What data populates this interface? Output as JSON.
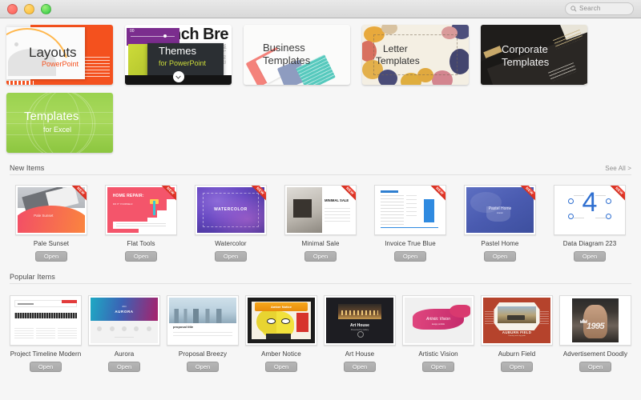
{
  "window": {
    "traffic_lights": [
      "close",
      "minimize",
      "maximize"
    ],
    "search": {
      "placeholder": "Search",
      "icon": "search-icon"
    }
  },
  "featured": {
    "cards": [
      {
        "id": "layouts",
        "title_line1": "Layouts",
        "title_line2": "PowerPoint",
        "body_text": "Lorem ipsum dolor sit consectetur adipiscing Vivamus"
      },
      {
        "id": "themes",
        "title_line1": "Themes",
        "title_line2": "for PowerPoint",
        "background_text": "nch Bre",
        "sidebar_text": "Vol 1 · no 21",
        "badge_text": "00"
      },
      {
        "id": "business",
        "title_line1": "Business",
        "title_line2": "Templates"
      },
      {
        "id": "letter",
        "title_line1": "Letter",
        "title_line2": "Templates"
      },
      {
        "id": "corporate",
        "title_line1": "Corporate",
        "title_line2": "Templates"
      },
      {
        "id": "excel",
        "title_line1": "Templates",
        "title_line2": "for Excel"
      }
    ]
  },
  "sections": [
    {
      "id": "new-items",
      "title": "New Items",
      "see_all": "See All >",
      "has_see_all": true,
      "ribbon_label": "NEW",
      "items": [
        {
          "id": "pale-sunset",
          "name": "Pale Sunset",
          "open_label": "Open",
          "badge": "NEW",
          "art": "a-pale",
          "art_text": "Pale Sunset"
        },
        {
          "id": "flat-tools",
          "name": "Flat Tools",
          "open_label": "Open",
          "badge": "NEW",
          "art": "a-flat",
          "art_text": "HOME REPAIR:",
          "art_sub": "DO IT YOURSELF"
        },
        {
          "id": "watercolor",
          "name": "Watercolor",
          "open_label": "Open",
          "badge": "NEW",
          "art": "a-water",
          "art_text": "WATERCOLOR"
        },
        {
          "id": "minimal-sale",
          "name": "Minimal Sale",
          "open_label": "Open",
          "badge": "NEW",
          "art": "a-min",
          "art_text": "MINIMAL SALE"
        },
        {
          "id": "invoice-true-blue",
          "name": "Invoice True Blue",
          "open_label": "Open",
          "badge": "NEW",
          "art": "a-inv"
        },
        {
          "id": "pastel-home",
          "name": "Pastel Home",
          "open_label": "Open",
          "badge": "NEW",
          "art": "a-pastel",
          "art_text": "Pastel Home",
          "art_sub": "interior"
        },
        {
          "id": "data-diagram-223",
          "name": "Data Diagram 223",
          "open_label": "Open",
          "badge": "NEW",
          "art": "a-data",
          "art_text": "4"
        }
      ]
    },
    {
      "id": "popular-items",
      "title": "Popular Items",
      "see_all": "",
      "has_see_all": false,
      "items": [
        {
          "id": "project-timeline-modern",
          "name": "Project Timeline Modern",
          "open_label": "Open",
          "art": "a-ptl",
          "art_text": "PROJECT TITLE"
        },
        {
          "id": "aurora",
          "name": "Aurora",
          "open_label": "Open",
          "art": "a-aurora",
          "art_text": "AURORA",
          "art_sub": "2016"
        },
        {
          "id": "proposal-breezy",
          "name": "Proposal Breezy",
          "open_label": "Open",
          "art": "a-breezy",
          "art_text": "proposal title"
        },
        {
          "id": "amber-notice",
          "name": "Amber Notice",
          "open_label": "Open",
          "art": "a-amber",
          "art_text": "Amber Notice"
        },
        {
          "id": "art-house",
          "name": "Art House",
          "open_label": "Open",
          "art": "a-arthouse",
          "art_text": "Art House",
          "art_sub": "Presented by Gallery"
        },
        {
          "id": "artistic-vision",
          "name": "Artistic Vision",
          "open_label": "Open",
          "art": "a-artistic",
          "art_text": "Artistic Vision",
          "art_sub": "design portfolio"
        },
        {
          "id": "auburn-field",
          "name": "Auburn Field",
          "open_label": "Open",
          "art": "a-auburn",
          "art_text": "AUBURN FIELD",
          "art_sub": "Country and city guide"
        },
        {
          "id": "advertisement-doodly",
          "name": "Advertisement Doodly",
          "open_label": "Open",
          "art": "a-ad",
          "art_text": "1995"
        }
      ]
    }
  ],
  "colors": {
    "window_bg": "#f6f6f6",
    "titlebar": "#e2e2e2",
    "accent_red": "#ef3b2d",
    "text_primary": "#3b3b3b",
    "text_secondary": "#8e8e8e",
    "excel_green": "#9ad24f",
    "powerpoint_orange": "#f4511e"
  }
}
